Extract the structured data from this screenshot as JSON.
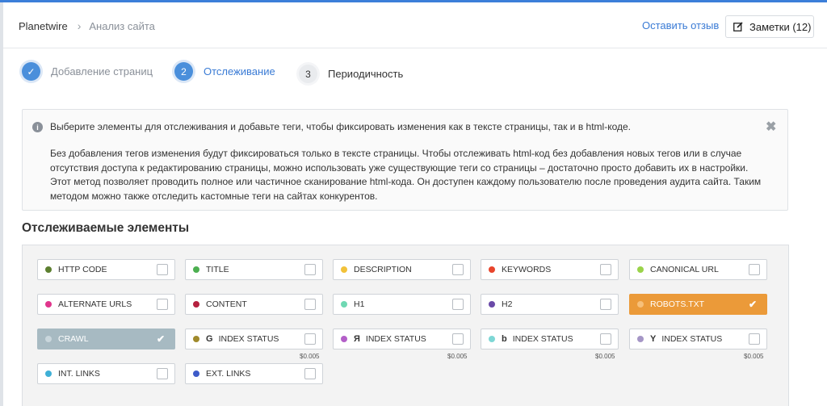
{
  "breadcrumb": {
    "root": "Planetwire",
    "separator": "›",
    "current": "Анализ сайта"
  },
  "header": {
    "feedback_label": "Оставить отзыв",
    "notes_label": "Заметки (12)"
  },
  "steps": [
    {
      "number": "✓",
      "label": "Добавление страниц",
      "state": "done"
    },
    {
      "number": "2",
      "label": "Отслеживание",
      "state": "active"
    },
    {
      "number": "3",
      "label": "Периодичность",
      "state": "todo"
    }
  ],
  "info": {
    "icon": "i",
    "title": "Выберите элементы для отслеживания и добавьте теги, чтобы фиксировать изменения как в тексте страницы, так и в html-коде.",
    "body": "Без добавления тегов изменения будут фиксироваться только в тексте страницы. Чтобы отслеживать html-код без добавления новых тегов или в случае отсутствия доступа к редактированию страницы, можно использовать уже существующие теги со страницы – достаточно просто добавить их в настройки. Этот метод позволяет проводить полное или частичное сканирование html-кода. Он доступен каждому пользователю после проведения аудита сайта. Таким методом можно также отследить кастомные теги на сайтах конкурентов.",
    "close": "✖"
  },
  "section_title": "Отслеживаемые элементы",
  "elements": [
    {
      "label": "HTTP CODE",
      "dot": "#5c7f2f",
      "checked": false
    },
    {
      "label": "TITLE",
      "dot": "#4caf50",
      "checked": false
    },
    {
      "label": "DESCRIPTION",
      "dot": "#f2c23a",
      "checked": false
    },
    {
      "label": "KEYWORDS",
      "dot": "#e8452c",
      "checked": false
    },
    {
      "label": "CANONICAL URL",
      "dot": "#9ad34a",
      "checked": false
    },
    {
      "label": "ALTERNATE URLS",
      "dot": "#e0358c",
      "checked": false
    },
    {
      "label": "CONTENT",
      "dot": "#b5213f",
      "checked": false
    },
    {
      "label": "H1",
      "dot": "#6fd8b3",
      "checked": false
    },
    {
      "label": "H2",
      "dot": "#6a4aa8",
      "checked": false
    },
    {
      "label": "ROBOTS.TXT",
      "dot": "#f7c07a",
      "checked": true
    },
    {
      "label": "CRAWL",
      "dot": "#c9d6dc",
      "checked": true
    },
    {
      "label": "INDEX STATUS",
      "dot": "#a08a2c",
      "checked": false,
      "glyph": "G",
      "price": "$0.005"
    },
    {
      "label": "INDEX STATUS",
      "dot": "#b35fc8",
      "checked": false,
      "glyph": "Я",
      "price": "$0.005"
    },
    {
      "label": "INDEX STATUS",
      "dot": "#7ed7d5",
      "checked": false,
      "glyph": "b",
      "price": "$0.005"
    },
    {
      "label": "INDEX STATUS",
      "dot": "#a596c6",
      "checked": false,
      "glyph": "Y",
      "price": "$0.005"
    },
    {
      "label": "INT. LINKS",
      "dot": "#3fb0d6",
      "checked": false
    },
    {
      "label": "EXT. LINKS",
      "dot": "#3d5bc9",
      "checked": false
    }
  ],
  "colors": {
    "accent": "#3a7bd5",
    "orange": "#eb9a39",
    "gray": "#a7bac2",
    "check": "✔"
  }
}
